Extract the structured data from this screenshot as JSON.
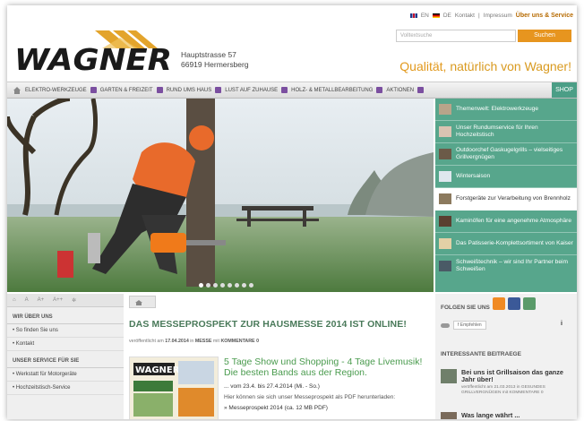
{
  "header": {
    "logo_text": "WAGNER",
    "address_line1": "Hauptstrasse 57",
    "address_line2": "66919 Hermersberg",
    "lang_en": "EN",
    "lang_de": "DE",
    "kontakt": "Kontakt",
    "separator": "|",
    "impressum": "Impressum",
    "about": "Über uns & Service",
    "search_placeholder": "Volltextsuche",
    "search_button": "Suchen",
    "slogan_accent": "Qualität,",
    "slogan_rest": "natürlich von Wagner!"
  },
  "nav": {
    "items": [
      "ELEKTRO-WERKZEUGE",
      "GARTEN & FREIZEIT",
      "RUND UMS HAUS",
      "LUST AUF ZUHAUSE",
      "HOLZ- & METALLBEARBEITUNG",
      "AKTIONEN"
    ],
    "shop": "SHOP"
  },
  "slider": {
    "dot_count": 8,
    "active_dot": 1,
    "items": [
      "Themenwelt: Elektrowerkzeuge",
      "Unser Rundumservice für Ihren Hochzeitstisch",
      "Outdoorchef Gaskugelgrills – vielseitiges Grillvergnügen",
      "Wintersaison",
      "Forstgeräte zur Verarbeitung von Brennholz",
      "Kaminöfen für eine angenehme Atmosphäre",
      "Das Patisserie-Komplettsortiment von Kaiser",
      "Schweißtechnik – wir sind Ihr Partner beim Schweißen"
    ],
    "selected_index": 4
  },
  "tools": {
    "a1": "A",
    "a2": "A+",
    "a3": "A++"
  },
  "left": {
    "head1": "WIR ÜBER UNS",
    "links1": [
      "So finden Sie uns",
      "Kontakt"
    ],
    "head2": "UNSER SERVICE FÜR SIE",
    "links2": [
      "Werkstatt für Motorgeräte",
      "Hochzeitstisch-Service"
    ]
  },
  "article": {
    "title": "DAS MESSEPROSPEKT ZUR HAUSMESSE 2014 IST ONLINE!",
    "meta_pre": "veröffentlicht am",
    "meta_date": "17.04.2014",
    "meta_in": "in",
    "meta_cat": "MESSE",
    "meta_mit": "mit",
    "meta_comments": "KOMMENTARE 0",
    "teaser_logo": "WAGNER",
    "headline": "5 Tage Show und Shopping - 4 Tage Livemusik! Die besten Bands aus der Region.",
    "dates": "... vom 23.4. bis 27.4.2014 (Mi. - So.)",
    "body": "Hier können sie sich unser Messeprospekt als PDF herunterladen:",
    "download": "» Messeprospekt 2014 (ca. 12 MB PDF)"
  },
  "sidebar": {
    "follow": "FOLGEN SIE UNS",
    "like": "Empfehlen",
    "info": "i",
    "interesting": "INTERESSANTE BEITRAEGE",
    "post1_title": "Bei uns ist Grillsaison das ganze Jahr über!",
    "post1_meta": "veröffentlicht am 21.03.2013 in GESUNDES GRILLVERGNÜGEN mit KOMMENTARE 0",
    "post2_title": "Was lange währt ..."
  },
  "colors": {
    "accent": "#e7951f",
    "green": "#57a68c",
    "nav_square": "#7b4fa0"
  }
}
